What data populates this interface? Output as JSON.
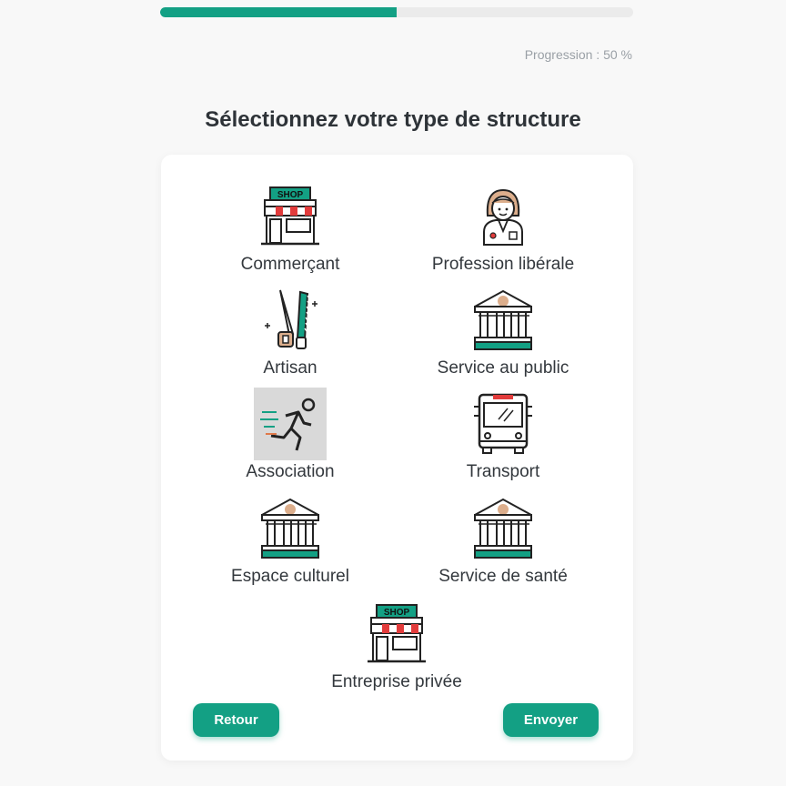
{
  "progress": {
    "value_percent": 50,
    "label": "Progression : 50 %"
  },
  "title": "Sélectionnez votre type de structure",
  "options": [
    {
      "label": "Commerçant",
      "icon": "shop-icon",
      "shop_sign": "SHOP",
      "selected": false
    },
    {
      "label": "Profession libérale",
      "icon": "doctor-icon",
      "selected": false
    },
    {
      "label": "Artisan",
      "icon": "saw-icon",
      "selected": false
    },
    {
      "label": "Service au public",
      "icon": "public-building-icon",
      "selected": false
    },
    {
      "label": "Association",
      "icon": "running-man-icon",
      "selected": true
    },
    {
      "label": "Transport",
      "icon": "bus-icon",
      "selected": false
    },
    {
      "label": "Espace culturel",
      "icon": "museum-icon",
      "selected": false
    },
    {
      "label": "Service de santé",
      "icon": "hospital-building-icon",
      "selected": false
    },
    {
      "label": "Entreprise privée",
      "icon": "shop-icon",
      "shop_sign": "SHOP",
      "selected": false
    }
  ],
  "buttons": {
    "back": "Retour",
    "submit": "Envoyer"
  },
  "colors": {
    "accent": "#13a084",
    "text": "#2e3338",
    "muted": "#9aa0a6",
    "selected_bg": "#d9d9d9",
    "awning_red": "#e23b3b",
    "skin": "#dcae8c"
  }
}
